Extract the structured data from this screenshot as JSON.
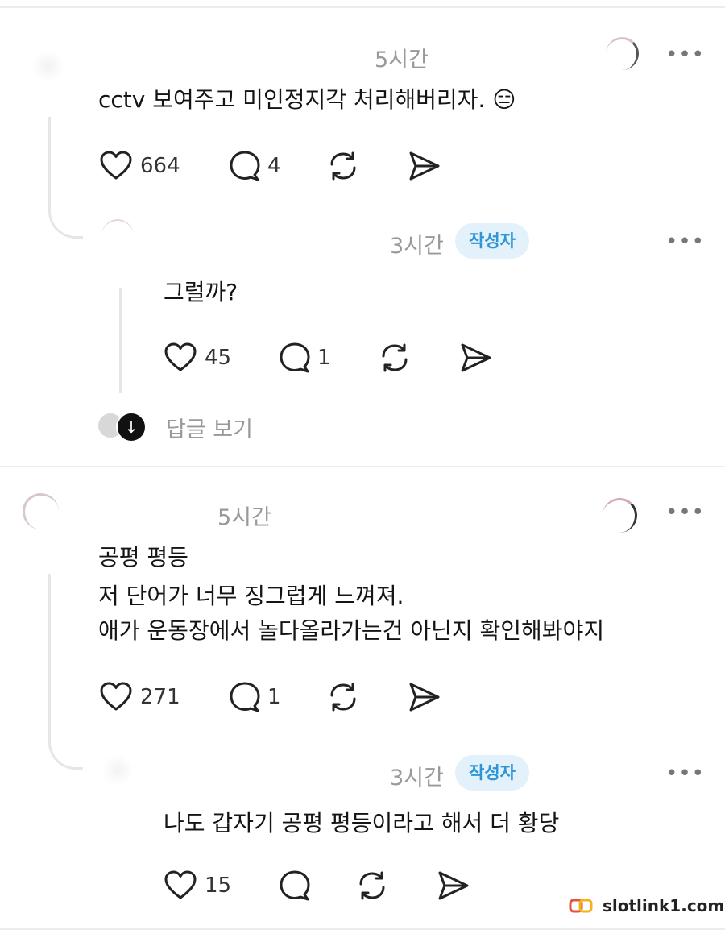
{
  "comments": [
    {
      "time": "5시간",
      "text": [
        "cctv 보여주고 미인정지각 처리해버리자."
      ],
      "emoji": "😑",
      "likes": "664",
      "replies": "4"
    },
    {
      "time": "3시간",
      "badge": "작성자",
      "text": [
        "그럴까?"
      ],
      "likes": "45",
      "replies": "1"
    },
    {
      "time": "5시간",
      "text": [
        "공평 평등",
        "저 단어가 너무 징그럽게 느껴져.",
        "애가 운동장에서 놀다올라가는건 아닌지 확인해봐야지"
      ],
      "likes": "271",
      "replies": "1"
    },
    {
      "time": "3시간",
      "badge": "작성자",
      "text": [
        "나도 갑자기 공평 평등이라고 해서 더 황당"
      ],
      "likes": "15",
      "replies": ""
    }
  ],
  "view_replies_label": "답글 보기",
  "more_label": "•••",
  "watermark": "slotlink1.com",
  "colors": {
    "badge_bg": "#e3f1fb",
    "badge_text": "#2f96d6",
    "muted": "#999999"
  }
}
